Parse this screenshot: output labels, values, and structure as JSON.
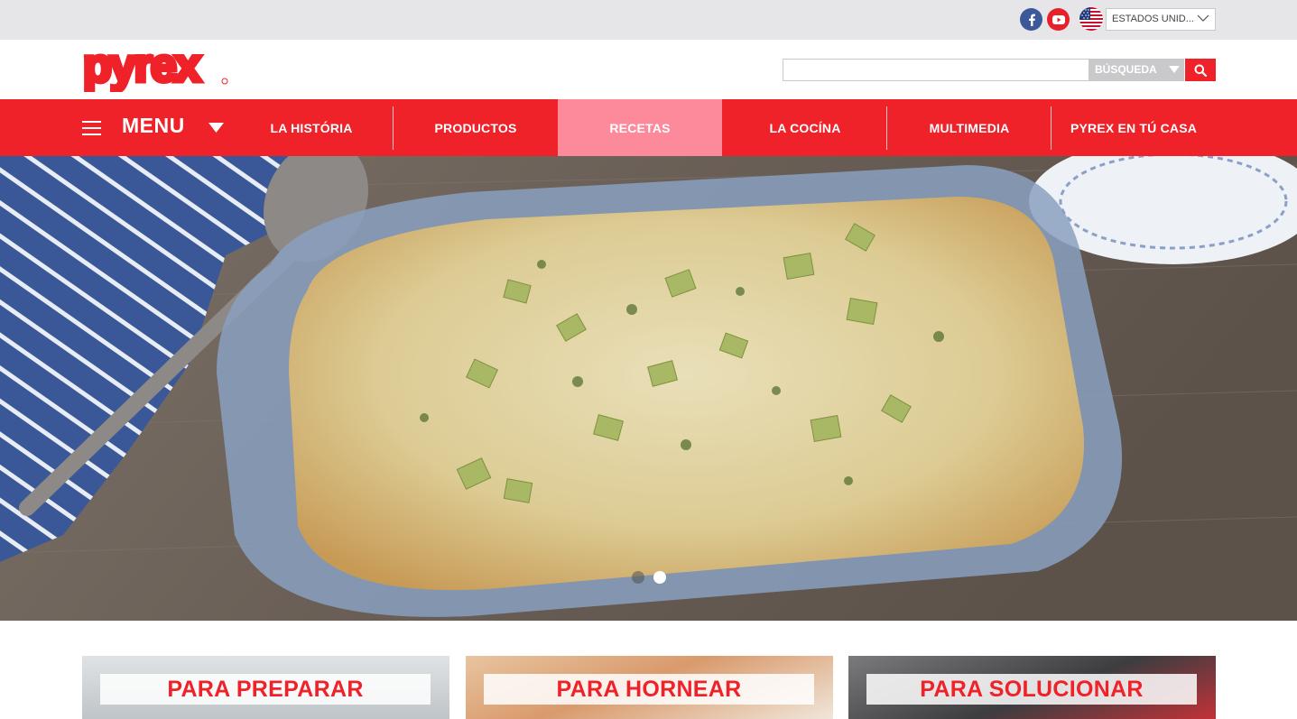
{
  "topbar": {
    "social": [
      {
        "icon": "facebook-icon"
      },
      {
        "icon": "youtube-icon"
      }
    ],
    "country": {
      "flag": "us-flag-icon",
      "label": "ESTADOS UNID..."
    }
  },
  "header": {
    "logo_text": "pyrex",
    "search": {
      "placeholder": "",
      "scope_label": "BÚSQUEDA"
    }
  },
  "nav": {
    "menu_label": "MENU",
    "items": [
      {
        "label": "LA HISTÓRIA"
      },
      {
        "label": "PRODUCTOS"
      },
      {
        "label": "RECETAS"
      },
      {
        "label": "LA COCÍNA"
      },
      {
        "label": "MULTIMEDIA"
      },
      {
        "label": "PYREX EN TÚ CASA"
      }
    ],
    "active_index": 2
  },
  "hero": {
    "slide_count": 2,
    "active_slide": 2
  },
  "categories": [
    {
      "label": "PARA PREPARAR"
    },
    {
      "label": "PARA HORNEAR"
    },
    {
      "label": "PARA SOLUCIONAR"
    }
  ],
  "colors": {
    "brand_red": "#ef2129",
    "active_tab": "#fd8a9a",
    "topbar_gray": "#e6e6e8"
  }
}
